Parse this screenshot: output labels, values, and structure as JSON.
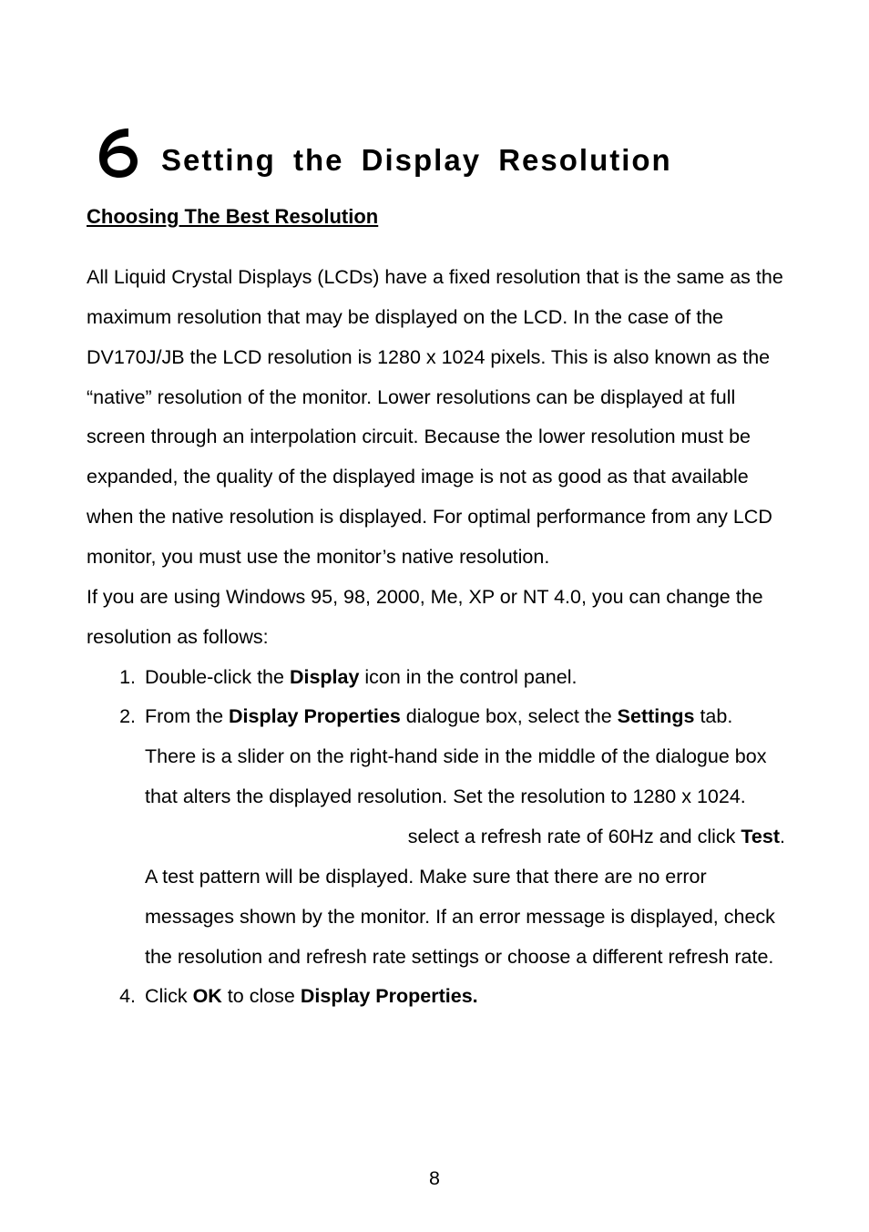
{
  "chapter": {
    "number": "6",
    "title": "Setting the Display Resolution"
  },
  "subheading": "Choosing The Best Resolution",
  "intro_para": "All Liquid Crystal Displays (LCDs) have a fixed resolution that is the same as the maximum resolution that may be displayed on the LCD. In the case of the DV170J/JB the LCD resolution is 1280 x 1024 pixels. This is also known as the “native” resolution of the monitor. Lower resolutions can be displayed at full screen through an interpolation circuit. Because the lower resolution must be expanded, the quality of the displayed image is not as good as that available when the native resolution is displayed. For optimal performance from any LCD monitor, you must use the monitor’s native resolution.",
  "windows_intro": "If you are using Windows 95, 98, 2000, Me, XP or NT 4.0, you can change the resolution as follows:",
  "steps": {
    "s1_a": "Double-click the ",
    "s1_b": "Display",
    "s1_c": " icon in the control panel.",
    "s2_a": "From the ",
    "s2_b": "Display Properties",
    "s2_c": " dialogue box, select the ",
    "s2_d": "Settings",
    "s2_e": " tab. There is a slider on the right-hand side in the middle of the dialogue box that alters the displayed resolution. Set the resolution to 1280 x 1024.",
    "s3_right_a": "select a refresh rate of 60Hz and click ",
    "s3_right_b": "Test",
    "s3_right_c": ".",
    "s3_body": "A test pattern will be displayed. Make sure that there are no error messages shown by the monitor. If an error message is displayed, check the resolution and refresh rate settings or choose a different refresh rate.",
    "s4_a": "Click ",
    "s4_b": "OK",
    "s4_c": " to close ",
    "s4_d": "Display Properties."
  },
  "page_number": "8"
}
